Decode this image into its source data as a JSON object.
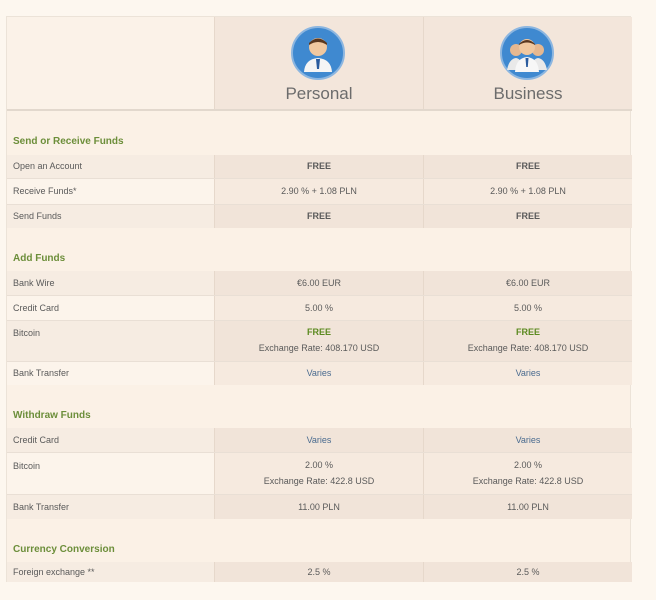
{
  "plans": {
    "personal": "Personal",
    "business": "Business"
  },
  "sections": [
    {
      "title": "Send or Receive Funds",
      "rows": [
        {
          "label": "Open an Account",
          "personal": "FREE",
          "business": "FREE"
        },
        {
          "label": "Receive Funds*",
          "personal": "2.90 % + 1.08 PLN",
          "business": "2.90 % + 1.08 PLN"
        },
        {
          "label": "Send Funds",
          "personal": "FREE",
          "business": "FREE"
        }
      ]
    },
    {
      "title": "Add Funds",
      "rows": [
        {
          "label": "Bank Wire",
          "personal": "€6.00 EUR",
          "business": "€6.00 EUR"
        },
        {
          "label": "Credit Card",
          "personal": "5.00 %",
          "business": "5.00 %"
        },
        {
          "label": "Bitcoin",
          "personal": "FREE",
          "personal_sub": "Exchange Rate: 408.170 USD",
          "business": "FREE",
          "business_sub": "Exchange Rate: 408.170 USD"
        },
        {
          "label": "Bank Transfer",
          "personal": "Varies",
          "business": "Varies"
        }
      ]
    },
    {
      "title": "Withdraw Funds",
      "rows": [
        {
          "label": "Credit Card",
          "personal": "Varies",
          "business": "Varies"
        },
        {
          "label": "Bitcoin",
          "personal": "2.00 %",
          "personal_sub": "Exchange Rate: 422.8 USD",
          "business": "2.00 %",
          "business_sub": "Exchange Rate: 422.8 USD"
        },
        {
          "label": "Bank Transfer",
          "personal": "11.00 PLN",
          "business": "11.00 PLN"
        }
      ]
    },
    {
      "title": "Currency Conversion",
      "rows": [
        {
          "label": "Foreign exchange **",
          "personal": "2.5 %",
          "business": "2.5 %"
        }
      ]
    }
  ],
  "colors": {
    "accent_green": "#6c8e3a",
    "free_green": "#5c8a20",
    "avatar_blue": "#3f89d0"
  },
  "icons": {
    "personal": "single-user-icon",
    "business": "group-users-icon"
  }
}
